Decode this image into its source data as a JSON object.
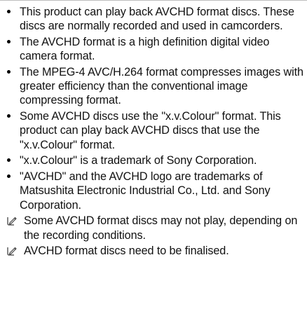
{
  "bullets": [
    "This product can play back AVCHD format discs. These discs are normally recorded and used in camcorders.",
    "The AVCHD format is a high definition digital video camera format.",
    "The MPEG-4 AVC/H.264 format compresses images with greater efficiency than the conventional image compressing format.",
    "Some AVCHD discs use the \"x.v.Colour\" format. This product can play back AVCHD discs that use the \"x.v.Colour\" format.",
    "\"x.v.Colour\" is a trademark of Sony Corporation.",
    "\"AVCHD\" and the AVCHD logo are trademarks of Matsushita Electronic Industrial Co., Ltd. and Sony Corporation."
  ],
  "notes": [
    "Some AVCHD format discs may not play, depending on the recording conditions.",
    "AVCHD format discs need to be finalised."
  ],
  "icons": {
    "note": "note-pencil-icon",
    "bullet": "bullet-dot"
  }
}
